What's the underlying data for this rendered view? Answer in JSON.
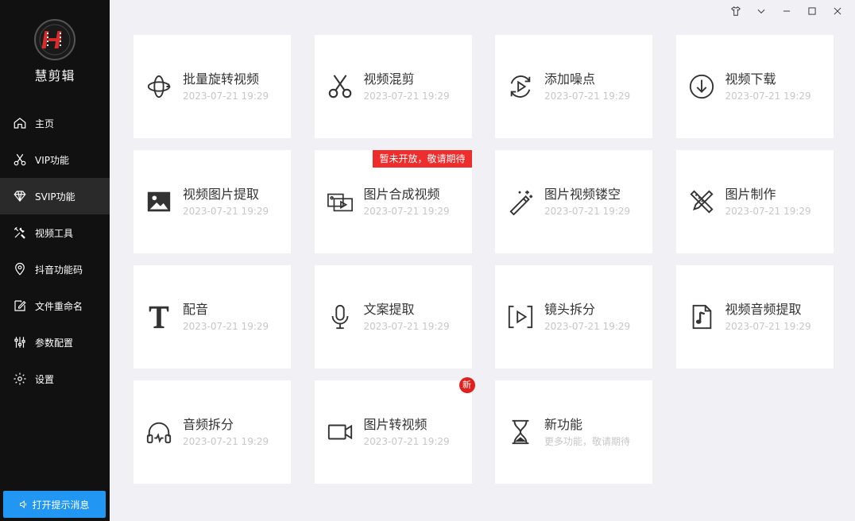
{
  "app": {
    "name": "慧剪辑"
  },
  "nav": {
    "items": [
      {
        "label": "主页",
        "icon": "home-icon"
      },
      {
        "label": "VIP功能",
        "icon": "scissors-icon"
      },
      {
        "label": "SVIP功能",
        "icon": "diamond-icon"
      },
      {
        "label": "视频工具",
        "icon": "tools-icon"
      },
      {
        "label": "抖音功能码",
        "icon": "location-pin-icon"
      },
      {
        "label": "文件重命名",
        "icon": "edit-file-icon"
      },
      {
        "label": "参数配置",
        "icon": "sliders-icon"
      },
      {
        "label": "设置",
        "icon": "gear-icon"
      }
    ],
    "active_index": 2
  },
  "notify_button": {
    "label": "打开提示消息",
    "icon": "speaker-icon"
  },
  "window_controls": [
    "shirt-icon",
    "chevron-down-icon",
    "minimize-icon",
    "maximize-icon",
    "close-icon"
  ],
  "cards": [
    {
      "title": "批量旋转视频",
      "date": "2023-07-21 19:29",
      "icon": "rotate-icon"
    },
    {
      "title": "视频混剪",
      "date": "2023-07-21 19:29",
      "icon": "scissors-icon"
    },
    {
      "title": "添加噪点",
      "date": "2023-07-21 19:29",
      "icon": "play-refresh-icon"
    },
    {
      "title": "视频下载",
      "date": "2023-07-21 19:29",
      "icon": "download-icon"
    },
    {
      "title": "视频图片提取",
      "date": "2023-07-21 19:29",
      "icon": "image-icon"
    },
    {
      "title": "图片合成视频",
      "date": "2023-07-21 19:29",
      "icon": "photos-video-icon",
      "banner": "暂未开放，敬请期待"
    },
    {
      "title": "图片视频镂空",
      "date": "2023-07-21 19:29",
      "icon": "magic-wand-icon"
    },
    {
      "title": "图片制作",
      "date": "2023-07-21 19:29",
      "icon": "pencil-ruler-icon"
    },
    {
      "title": "配音",
      "date": "2023-07-21 19:29",
      "icon": "text-t-icon"
    },
    {
      "title": "文案提取",
      "date": "2023-07-21 19:29",
      "icon": "microphone-icon"
    },
    {
      "title": "镜头拆分",
      "date": "2023-07-21 19:29",
      "icon": "frame-play-icon"
    },
    {
      "title": "视频音频提取",
      "date": "2023-07-21 19:29",
      "icon": "music-file-icon"
    },
    {
      "title": "音频拆分",
      "date": "2023-07-21 19:29",
      "icon": "headphones-icon"
    },
    {
      "title": "图片转视频",
      "date": "2023-07-21 19:29",
      "icon": "video-camera-icon",
      "new_badge": "新"
    },
    {
      "title": "新功能",
      "date": "更多功能，敬请期待",
      "icon": "hourglass-icon"
    }
  ],
  "colors": {
    "sidebar": "#111111",
    "active": "#2a2a2a",
    "accent": "#2196f3",
    "badge": "#ee2d2d",
    "background": "#f0f0f5"
  }
}
